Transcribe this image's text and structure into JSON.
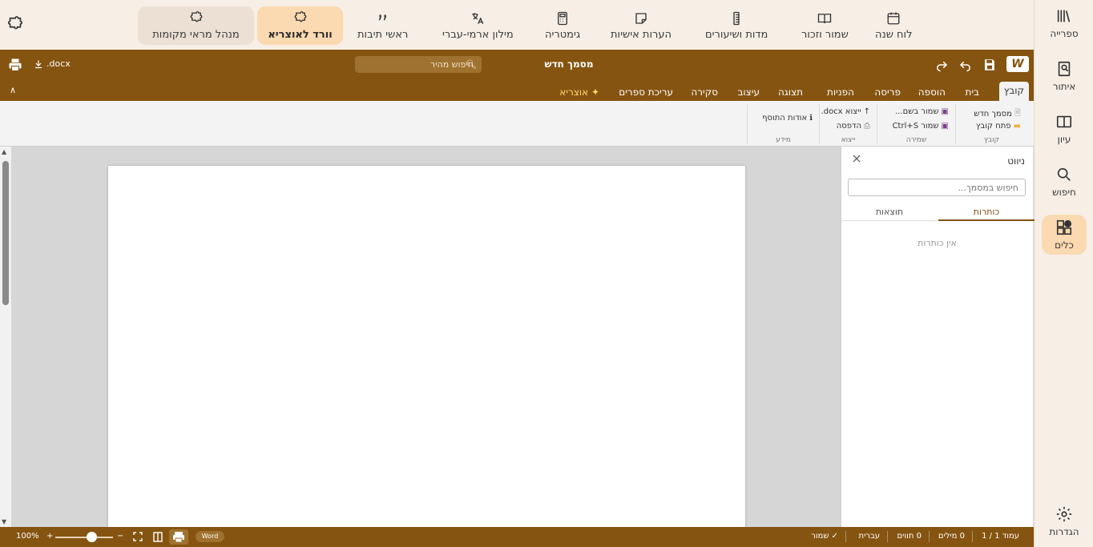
{
  "sidebar": {
    "items": [
      {
        "label": "ספרייה",
        "icon": "library-icon"
      },
      {
        "label": "איתור",
        "icon": "find-book-icon"
      },
      {
        "label": "עיון",
        "icon": "open-book-icon"
      },
      {
        "label": "חיפוש",
        "icon": "search-icon"
      },
      {
        "label": "כלים",
        "icon": "tools-grid-icon",
        "active": true
      }
    ],
    "settings_label": "הגדרות"
  },
  "tools": [
    {
      "label": "לוח שנה",
      "icon": "calendar-icon"
    },
    {
      "label": "שמור וזכור",
      "icon": "book-icon"
    },
    {
      "label": "מדות ושיעורים",
      "icon": "ruler-icon"
    },
    {
      "label": "הערות אישיות",
      "icon": "note-icon"
    },
    {
      "label": "גימטריה",
      "icon": "calculator-icon"
    },
    {
      "label": "מילון ארמי-עברי",
      "icon": "translate-icon"
    },
    {
      "label": "ראשי תיבות",
      "icon": "quote-icon"
    },
    {
      "label": "וורד לאוצריא",
      "icon": "puzzle-icon",
      "active": true
    },
    {
      "label": "מנהל מראי מקומות",
      "icon": "puzzle-icon"
    }
  ],
  "word": {
    "logo": "W",
    "doc_title": "מסמך חדש",
    "quick_search_placeholder": "חיפוש מהיר",
    "docx_label": "docx.",
    "tabs": [
      "קובץ",
      "בית",
      "הוספה",
      "פריסה",
      "הפניות",
      "תצוגה",
      "עיצוב",
      "סקירה",
      "עריכת ספרים",
      "✦ אוצריא"
    ],
    "ribbon": {
      "file_group": {
        "new_doc": "מסמך חדש",
        "open_file": "פתח קובץ",
        "label": "קובץ"
      },
      "save_group": {
        "save_as": "שמור בשם...",
        "save": "שמור Ctrl+S",
        "label": "שמירה"
      },
      "export_group": {
        "export_docx": "ייצוא docx.",
        "print": "הדפסה",
        "label": "ייצוא"
      },
      "info_group": {
        "about": "אודות התוסף",
        "label": "מידע"
      }
    },
    "nav_pane": {
      "title": "ניווט",
      "search_placeholder": "חיפוש במסמך...",
      "tab_headings": "כותרות",
      "tab_results": "תוצאות",
      "empty": "אין כותרות"
    },
    "status": {
      "page": "עמוד 1 / 1",
      "words": "0 מילים",
      "chars": "0 תווים",
      "language": "עברית",
      "saved": "✓ שמור",
      "zoom": "100%",
      "zoom_plus": "+",
      "zoom_minus": "−",
      "word_badge": "Word"
    }
  }
}
